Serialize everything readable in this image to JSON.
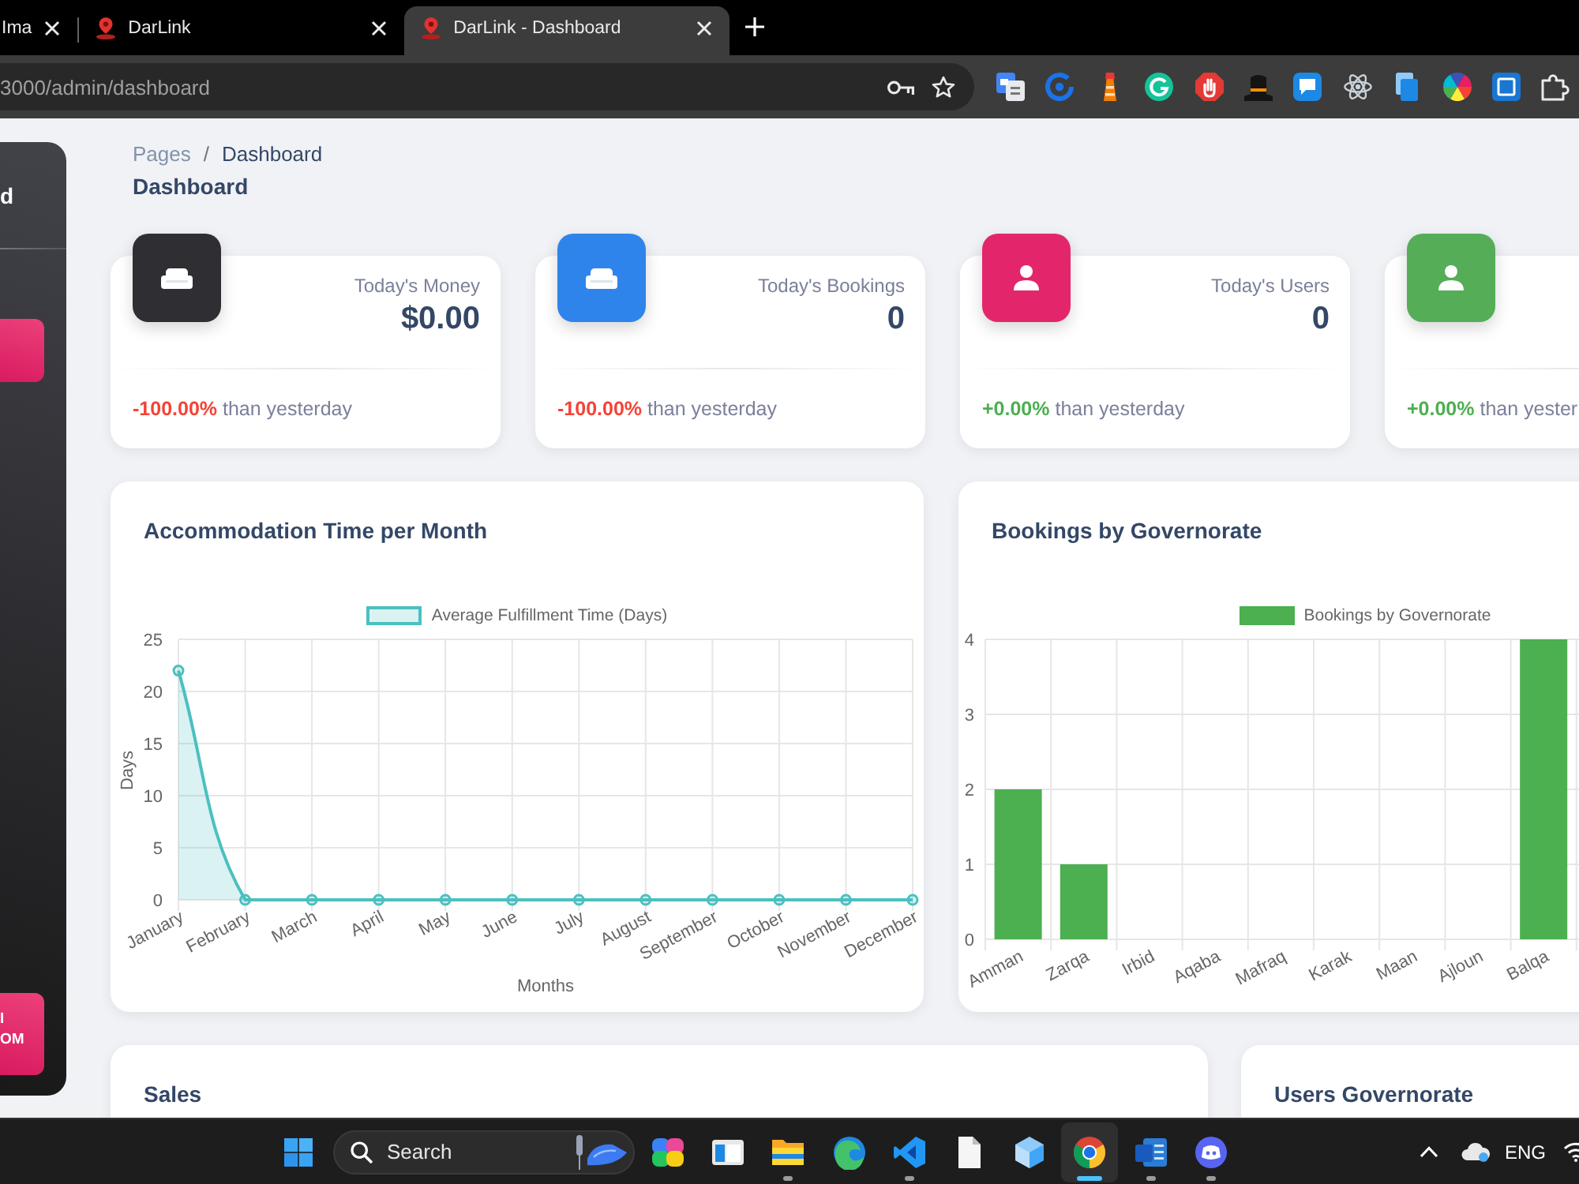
{
  "browser": {
    "tabs": [
      {
        "title": "Ima",
        "favicon": false,
        "selected": false
      },
      {
        "title": "DarLink",
        "favicon": true,
        "selected": false
      },
      {
        "title": "DarLink - Dashboard",
        "favicon": true,
        "selected": true
      }
    ],
    "url": "3000/admin/dashboard"
  },
  "sidebar": {
    "brand": "d",
    "items": [
      {
        "selected": true
      }
    ],
    "button": [
      "I",
      "OM"
    ]
  },
  "breadcrumb": {
    "items": [
      "Pages",
      "Dashboard"
    ],
    "separator": "/",
    "title": "Dashboard"
  },
  "stats": [
    {
      "kind": "sofa",
      "color": "#2e2e33",
      "label": "Today's Money",
      "value": "$0.00",
      "change": "-100.00%",
      "increase": false,
      "note": "than yesterday"
    },
    {
      "kind": "sofa",
      "color": "#2f84ec",
      "label": "Today's Bookings",
      "value": "0",
      "change": "-100.00%",
      "increase": false,
      "note": "than yesterday"
    },
    {
      "kind": "user",
      "color": "#e3266b",
      "label": "Today's Users",
      "value": "0",
      "change": "+0.00%",
      "increase": true,
      "note": "than yesterday"
    },
    {
      "kind": "user",
      "color": "#55ad58",
      "change": "+0.00%",
      "increase": true,
      "note": "than yester"
    }
  ],
  "charts": [
    {
      "title": "Accommodation Time per Month",
      "chart_data": {
        "type": "area",
        "categories": [
          "January",
          "February",
          "March",
          "April",
          "May",
          "June",
          "July",
          "August",
          "September",
          "October",
          "November",
          "December"
        ],
        "series": [
          {
            "name": "Average Fulfillment Time (Days)",
            "color": "#4bc0c0",
            "values": [
              22,
              0,
              0,
              0,
              0,
              0,
              0,
              0,
              0,
              0,
              0,
              0
            ]
          }
        ],
        "xlabel": "Months",
        "ylabel": "Days",
        "ylim": [
          0,
          25
        ],
        "yticks": [
          0,
          5,
          10,
          15,
          20,
          25
        ],
        "grid": true
      }
    },
    {
      "title": "Bookings by Governorate",
      "chart_data": {
        "type": "bar",
        "categories": [
          "Amman",
          "Zarqa",
          "Irbid",
          "Aqaba",
          "Mafraq",
          "Karak",
          "Maan",
          "Ajloun",
          "Balqa"
        ],
        "series": [
          {
            "name": "Bookings by Governorate",
            "color": "#4caf50",
            "values": [
              2,
              1,
              0,
              0,
              0,
              0,
              0,
              0,
              4
            ]
          }
        ],
        "ylim": [
          0,
          4
        ],
        "yticks": [
          0,
          1,
          2,
          3,
          4
        ],
        "grid": true
      }
    }
  ],
  "panels": [
    {
      "title": "Sales"
    },
    {
      "title": "Users Governorate"
    }
  ],
  "taskbar": {
    "search": {
      "placeholder": "Search"
    },
    "apps": [
      {
        "kind": "knot",
        "running": false,
        "selected": false
      },
      {
        "kind": "window",
        "running": false,
        "selected": false
      },
      {
        "kind": "folder",
        "running": true,
        "selected": false
      },
      {
        "kind": "swirl",
        "running": false,
        "selected": false
      },
      {
        "kind": "ribbon",
        "running": true,
        "selected": false
      },
      {
        "kind": "page",
        "running": false,
        "selected": false
      },
      {
        "kind": "cube",
        "running": false,
        "selected": false
      },
      {
        "kind": "tricolor",
        "running": true,
        "selected": true
      },
      {
        "kind": "sheets",
        "running": true,
        "selected": false
      },
      {
        "kind": "gamepad",
        "running": true,
        "selected": false
      }
    ],
    "language": "ENG"
  }
}
